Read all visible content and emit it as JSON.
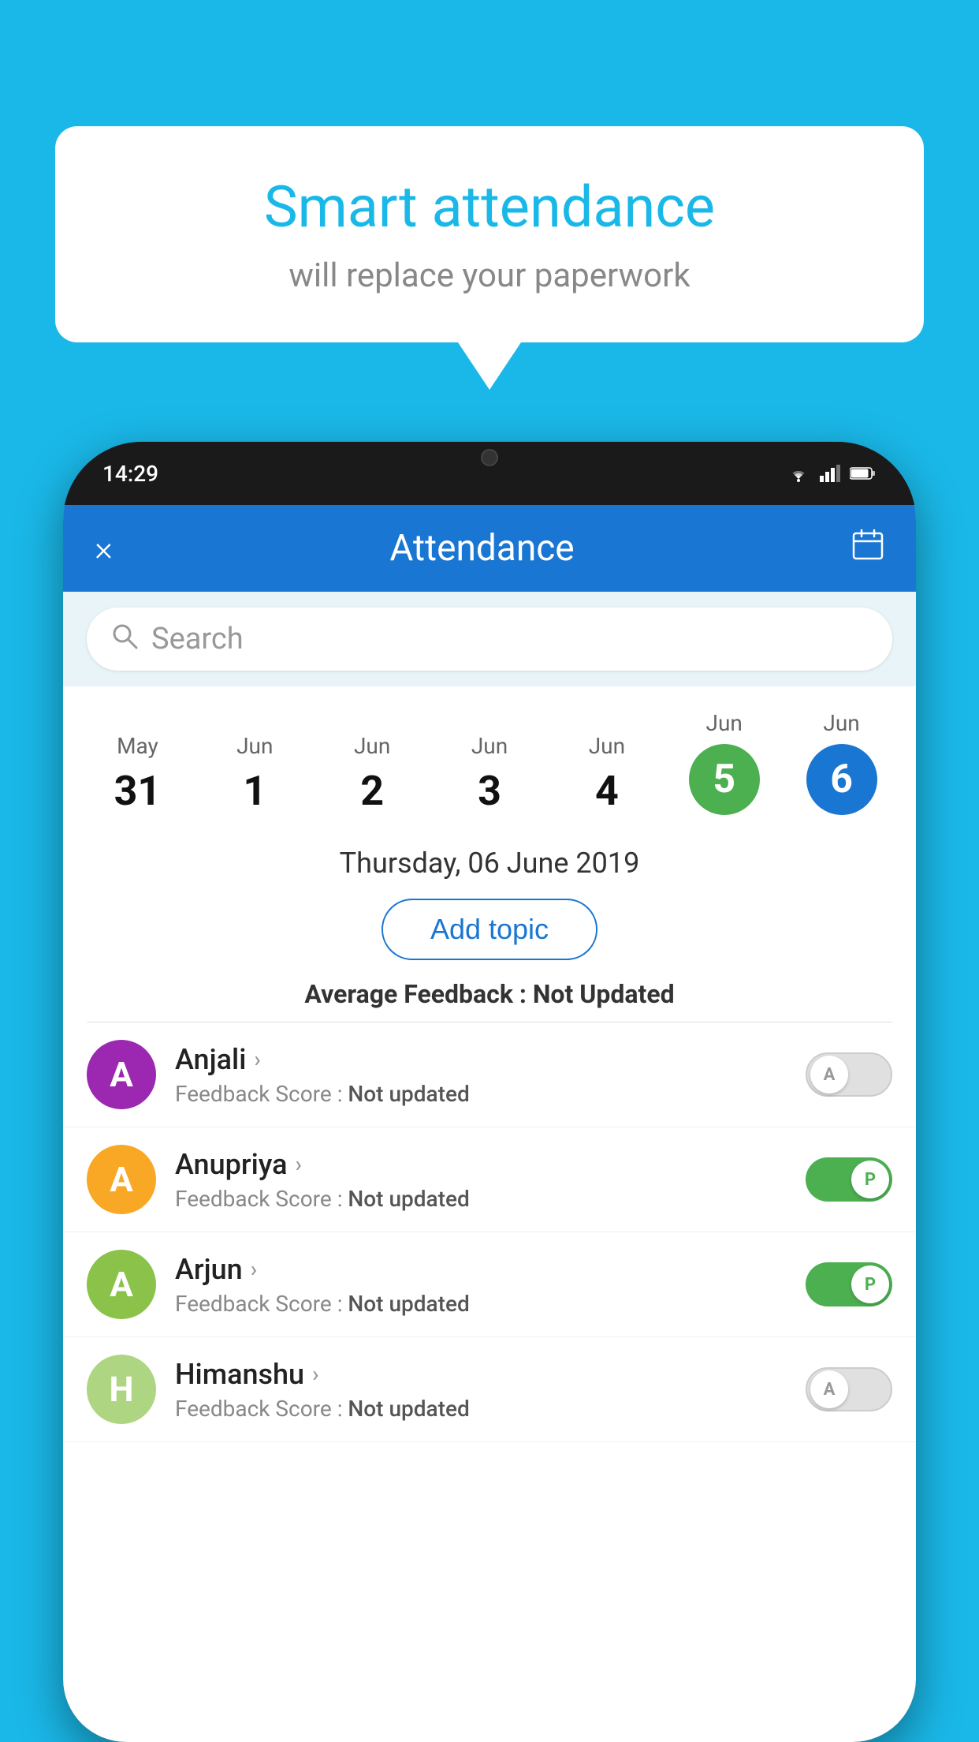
{
  "background_color": "#1ab8e8",
  "speech_bubble": {
    "title": "Smart attendance",
    "subtitle": "will replace your paperwork"
  },
  "status_bar": {
    "time": "14:29",
    "wifi": "▼▲",
    "signal": "▲",
    "battery": "▮"
  },
  "header": {
    "title": "Attendance",
    "close_icon": "×",
    "calendar_icon": "📅"
  },
  "search": {
    "placeholder": "Search"
  },
  "date_selector": {
    "dates": [
      {
        "month": "May",
        "day": "31",
        "active": false
      },
      {
        "month": "Jun",
        "day": "1",
        "active": false
      },
      {
        "month": "Jun",
        "day": "2",
        "active": false
      },
      {
        "month": "Jun",
        "day": "3",
        "active": false
      },
      {
        "month": "Jun",
        "day": "4",
        "active": false
      },
      {
        "month": "Jun",
        "day": "5",
        "active": "green"
      },
      {
        "month": "Jun",
        "day": "6",
        "active": "blue"
      }
    ]
  },
  "selected_date": "Thursday, 06 June 2019",
  "add_topic_label": "Add topic",
  "avg_feedback_label": "Average Feedback :",
  "avg_feedback_value": "Not Updated",
  "students": [
    {
      "name": "Anjali",
      "avatar_letter": "A",
      "avatar_color": "#9c27b0",
      "feedback_label": "Feedback Score :",
      "feedback_value": "Not updated",
      "toggle_state": "off",
      "toggle_letter": "A"
    },
    {
      "name": "Anupriya",
      "avatar_letter": "A",
      "avatar_color": "#f9a825",
      "feedback_label": "Feedback Score :",
      "feedback_value": "Not updated",
      "toggle_state": "on",
      "toggle_letter": "P"
    },
    {
      "name": "Arjun",
      "avatar_letter": "A",
      "avatar_color": "#8bc34a",
      "feedback_label": "Feedback Score :",
      "feedback_value": "Not updated",
      "toggle_state": "on",
      "toggle_letter": "P"
    },
    {
      "name": "Himanshu",
      "avatar_letter": "H",
      "avatar_color": "#aed581",
      "feedback_label": "Feedback Score :",
      "feedback_value": "Not updated",
      "toggle_state": "off",
      "toggle_letter": "A"
    }
  ]
}
